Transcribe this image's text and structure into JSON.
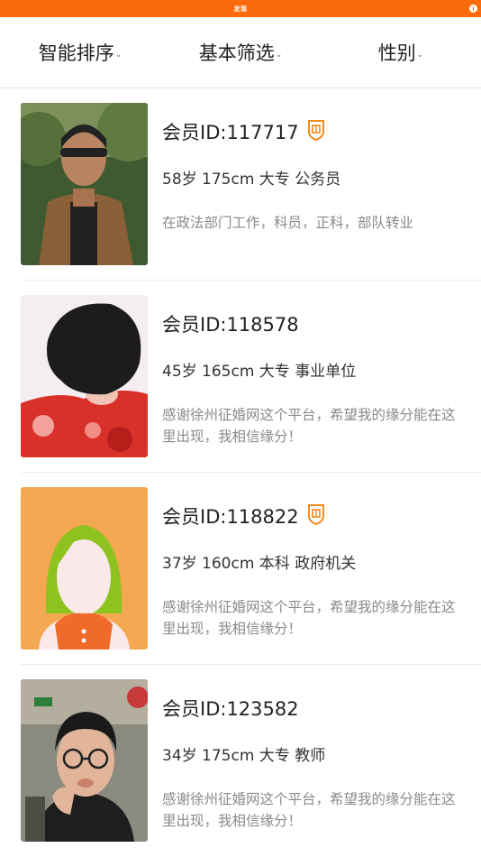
{
  "statusbar": {
    "title": "发现"
  },
  "filters": [
    {
      "label": "智能排序"
    },
    {
      "label": "基本筛选"
    },
    {
      "label": "性别"
    }
  ],
  "members": [
    {
      "id_text": "会员ID:117717",
      "verified": true,
      "stats": "58岁 175cm 大专 公务员",
      "desc": "在政法部门工作，科员，正科，部队转业"
    },
    {
      "id_text": "会员ID:118578",
      "verified": false,
      "stats": "45岁 165cm 大专 事业单位",
      "desc": "感谢徐州征婚网这个平台，希望我的缘分能在这里出现，我相信缘分！"
    },
    {
      "id_text": "会员ID:118822",
      "verified": true,
      "stats": "37岁 160cm 本科 政府机关",
      "desc": "感谢徐州征婚网这个平台，希望我的缘分能在这里出现，我相信缘分！"
    },
    {
      "id_text": "会员ID:123582",
      "verified": false,
      "stats": "34岁 175cm 大专 教师",
      "desc": "感谢徐州征婚网这个平台，希望我的缘分能在这里出现，我相信缘分！"
    }
  ],
  "colors": {
    "accent": "#fb6b0b"
  }
}
